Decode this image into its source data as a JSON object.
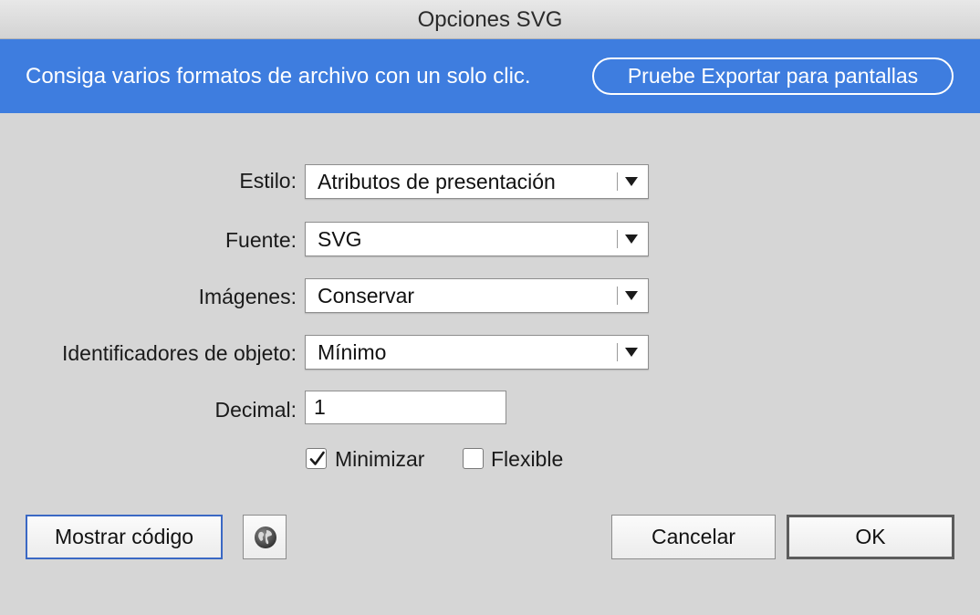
{
  "window": {
    "title": "Opciones SVG"
  },
  "banner": {
    "text": "Consiga varios formatos de archivo con un solo clic.",
    "button_label": "Pruebe Exportar para pantallas",
    "background": "#3e7ddf"
  },
  "form": {
    "style": {
      "label": "Estilo:",
      "value": "Atributos de presentación"
    },
    "font": {
      "label": "Fuente:",
      "value": "SVG"
    },
    "images": {
      "label": "Imágenes:",
      "value": "Conservar"
    },
    "object_ids": {
      "label": "Identificadores de objeto:",
      "value": "Mínimo"
    },
    "decimal": {
      "label": "Decimal:",
      "value": "1"
    },
    "minify": {
      "label": "Minimizar",
      "checked": true
    },
    "responsive": {
      "label": "Flexible",
      "checked": false
    }
  },
  "footer": {
    "show_code_label": "Mostrar código",
    "globe_icon": "globe-icon",
    "cancel_label": "Cancelar",
    "ok_label": "OK"
  },
  "colors": {
    "accent_focus": "#3a68c4"
  }
}
